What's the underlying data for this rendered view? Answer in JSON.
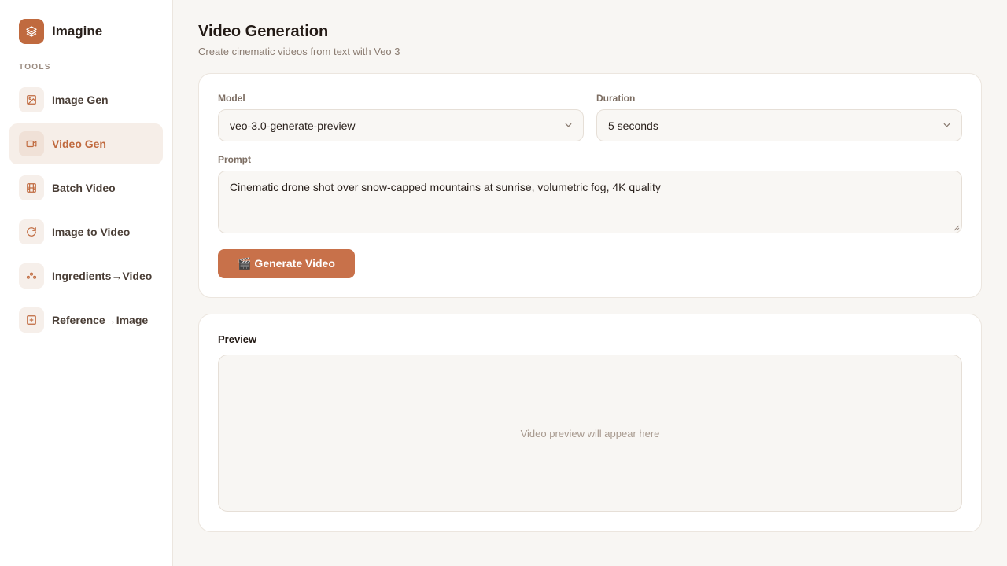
{
  "brand": {
    "name": "Imagine",
    "accent": "#c06a3f"
  },
  "sidebar": {
    "section_label": "TOOLS",
    "items": [
      {
        "label": "Image Gen",
        "icon": "image-icon",
        "active": false
      },
      {
        "label": "Video Gen",
        "icon": "video-icon",
        "active": true
      },
      {
        "label": "Batch Video",
        "icon": "film-icon",
        "active": false
      },
      {
        "label": "Image to Video",
        "icon": "refresh-icon",
        "active": false
      },
      {
        "label": "Ingredients→Video",
        "icon": "ingredients-icon",
        "active": false
      },
      {
        "label": "Reference→Image",
        "icon": "plus-square-icon",
        "active": false
      }
    ]
  },
  "header": {
    "title": "Video Generation",
    "subtitle": "Create cinematic videos from text with Veo 3"
  },
  "form": {
    "model_label": "Model",
    "model_value": "veo-3.0-generate-preview",
    "duration_label": "Duration",
    "duration_value": "5 seconds",
    "prompt_label": "Prompt",
    "prompt_value": "Cinematic drone shot over snow-capped mountains at sunrise, volumetric fog, 4K quality",
    "generate_label": "🎬 Generate Video"
  },
  "preview": {
    "title": "Preview",
    "placeholder": "Video preview will appear here"
  }
}
